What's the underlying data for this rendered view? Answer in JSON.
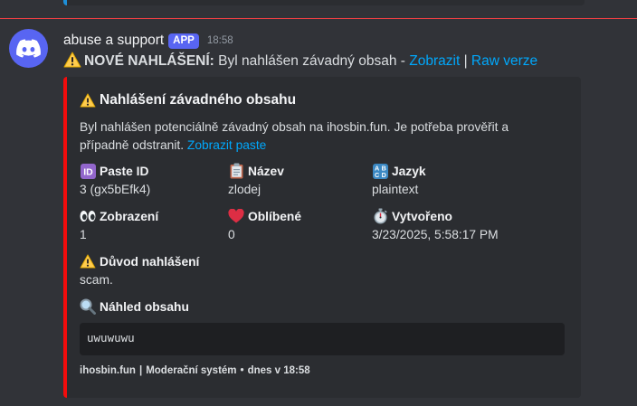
{
  "message": {
    "username": "abuse a support",
    "app_tag": "APP",
    "timestamp": "18:58",
    "content_bold": "NOVÉ NAHLÁŠENÍ:",
    "content_text": "Byl nahlášen závadný obsah -",
    "content_link_show": "Zobrazit",
    "content_separator": "|",
    "content_link_raw": "Raw verze"
  },
  "embed": {
    "color": "#f20c0c",
    "title": "Nahlášení závadného obsahu",
    "description": "Byl nahlášen potenciálně závadný obsah na ihosbin.fun. Je potřeba prověřit a případně odstranit.",
    "description_link": "Zobrazit paste",
    "fields": {
      "paste_id": {
        "name": "Paste ID",
        "value": "3 (gx5bEfk4)",
        "icon": "id-icon"
      },
      "title": {
        "name": "Název",
        "value": "zlodej",
        "icon": "clipboard-icon"
      },
      "language": {
        "name": "Jazyk",
        "value": "plaintext",
        "icon": "abcd-icon"
      },
      "views": {
        "name": "Zobrazení",
        "value": "1",
        "icon": "eyes-icon"
      },
      "likes": {
        "name": "Oblíbené",
        "value": "0",
        "icon": "heart-icon"
      },
      "created": {
        "name": "Vytvořeno",
        "value": "3/23/2025, 5:58:17 PM",
        "icon": "stopwatch-icon"
      },
      "reason": {
        "name": "Důvod nahlášení",
        "value": "scam.",
        "icon": "warning-icon"
      },
      "preview": {
        "name": "Náhled obsahu",
        "value": "uwuwuwu",
        "icon": "magnifier-icon"
      }
    },
    "footer_site": "ihosbin.fun",
    "footer_separator": "|",
    "footer_system": "Moderační systém",
    "footer_dot": "•",
    "footer_time": "dnes v 18:58"
  }
}
